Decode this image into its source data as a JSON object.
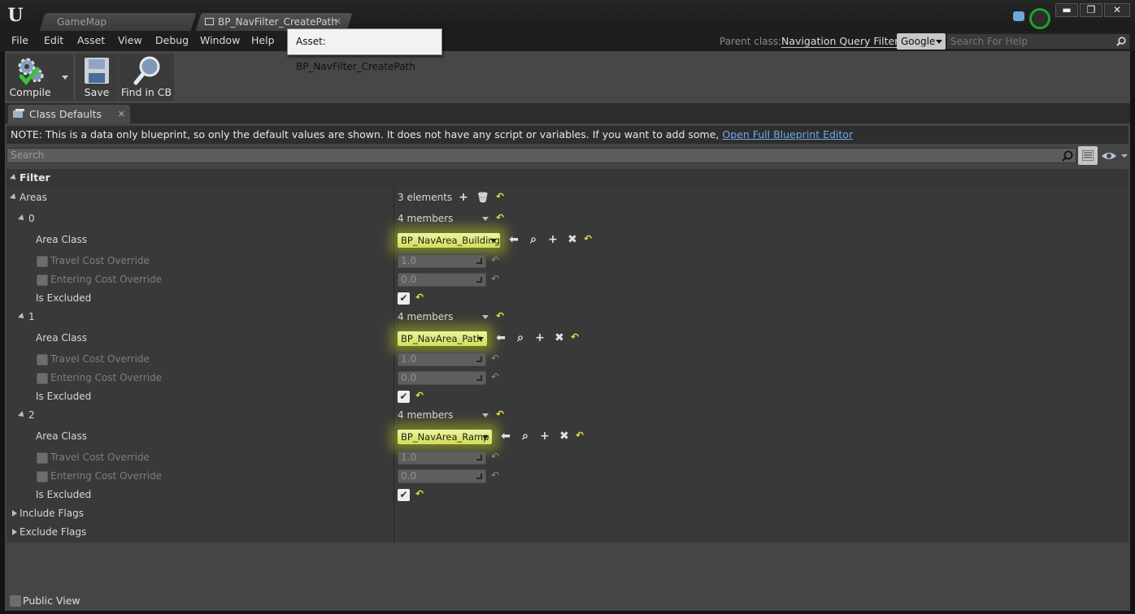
{
  "app": {
    "tabs": [
      {
        "label": "GameMap"
      },
      {
        "label": "BP_NavFilter_CreatePath"
      }
    ],
    "window_controls": {
      "minimize": "▬",
      "restore": "❐",
      "close": "✕"
    }
  },
  "menu": {
    "items": [
      "File",
      "Edit",
      "Asset",
      "View",
      "Debug",
      "Window",
      "Help"
    ],
    "tooltip": "Asset: BP_NavFilter_CreatePath",
    "parent_class_label": "Parent class:",
    "parent_class_value": "Navigation Query Filter",
    "search_provider": "Google",
    "help_search_placeholder": "Search For Help"
  },
  "toolbar": {
    "compile_label": "Compile",
    "save_label": "Save",
    "find_label": "Find in CB"
  },
  "details": {
    "tab_label": "Class Defaults",
    "note_text": "NOTE: This is a data only blueprint, so only the default values are shown.  It does not have any script or variables.  If you want to add some, ",
    "note_link": "Open Full Blueprint Editor",
    "search_placeholder": "Search",
    "category": "Filter",
    "areas_label": "Areas",
    "areas_count": "3 elements",
    "elements": [
      {
        "index": "0",
        "members": "4 members",
        "area_class_label": "Area Class",
        "area_class": "BP_NavArea_Building",
        "travel_label": "Travel Cost Override",
        "travel_value": "1.0",
        "entering_label": "Entering Cost Override",
        "entering_value": "0.0",
        "excluded_label": "Is Excluded",
        "excluded": true
      },
      {
        "index": "1",
        "members": "4 members",
        "area_class_label": "Area Class",
        "area_class": "BP_NavArea_Path",
        "travel_label": "Travel Cost Override",
        "travel_value": "1.0",
        "entering_label": "Entering Cost Override",
        "entering_value": "0.0",
        "excluded_label": "Is Excluded",
        "excluded": true
      },
      {
        "index": "2",
        "members": "4 members",
        "area_class_label": "Area Class",
        "area_class": "BP_NavArea_Ramp",
        "travel_label": "Travel Cost Override",
        "travel_value": "1.0",
        "entering_label": "Entering Cost Override",
        "entering_value": "0.0",
        "excluded_label": "Is Excluded",
        "excluded": true
      }
    ],
    "include_flags": "Include Flags",
    "exclude_flags": "Exclude Flags",
    "public_view": "Public View"
  },
  "colors": {
    "accent_highlight": "#d3de55",
    "reset_arrow": "#e8d84a",
    "link": "#6ea9e8",
    "source_control": "#1fa32a"
  }
}
